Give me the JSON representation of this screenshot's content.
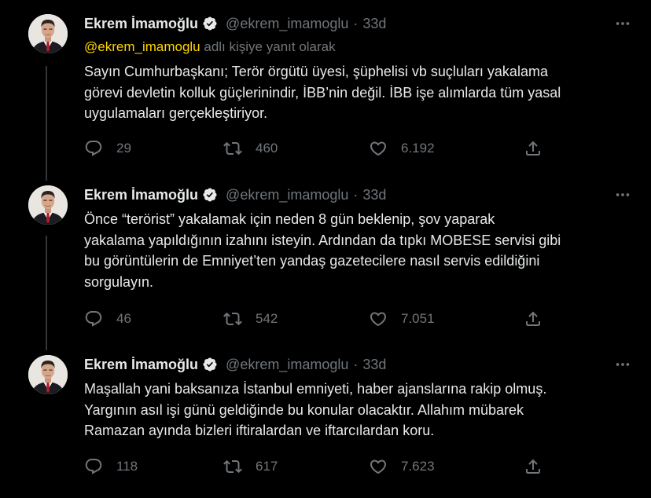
{
  "tweets": [
    {
      "name": "Ekrem İmamoğlu",
      "handle": "@ekrem_imamoglu",
      "time": "33d",
      "reply_to": "@ekrem_imamoglu",
      "reply_suffix": "adlı kişiye yanıt olarak",
      "text": "Sayın Cumhurbaşkanı; Terör örgütü üyesi, şüphelisi vb suçluları yakalama\ngörevi devletin kolluk güçlerinindir, İBB’nin değil. İBB işe alımlarda tüm yasal\nuygulamaları gerçekleştiriyor.",
      "replies": "29",
      "retweets": "460",
      "likes": "6.192"
    },
    {
      "name": "Ekrem İmamoğlu",
      "handle": "@ekrem_imamoglu",
      "time": "33d",
      "text": "Önce “terörist” yakalamak için neden 8 gün beklenip, şov yaparak\nyakalama yapıldığının izahını isteyin. Ardından da tıpkı MOBESE servisi gibi\nbu görüntülerin de Emniyet’ten yandaş gazetecilere nasıl servis edildiğini\nsorgulayın.",
      "replies": "46",
      "retweets": "542",
      "likes": "7.051"
    },
    {
      "name": "Ekrem İmamoğlu",
      "handle": "@ekrem_imamoglu",
      "time": "33d",
      "text": "Maşallah yani baksanıza İstanbul emniyeti, haber ajanslarına rakip olmuş.\nYargının asıl işi günü geldiğinde bu konular olacaktır. Allahım mübarek\nRamazan ayında bizleri iftiralardan ve iftarcılardan koru.",
      "replies": "118",
      "retweets": "617",
      "likes": "7.623"
    }
  ],
  "dot_separator": "·",
  "colors": {
    "background": "#000000",
    "text": "#e7e9ea",
    "muted": "#71767b",
    "mention": "#ffd400",
    "thread_line": "#333639"
  },
  "icons": [
    "verified-icon",
    "more-icon",
    "reply-icon",
    "retweet-icon",
    "like-icon",
    "share-icon"
  ]
}
